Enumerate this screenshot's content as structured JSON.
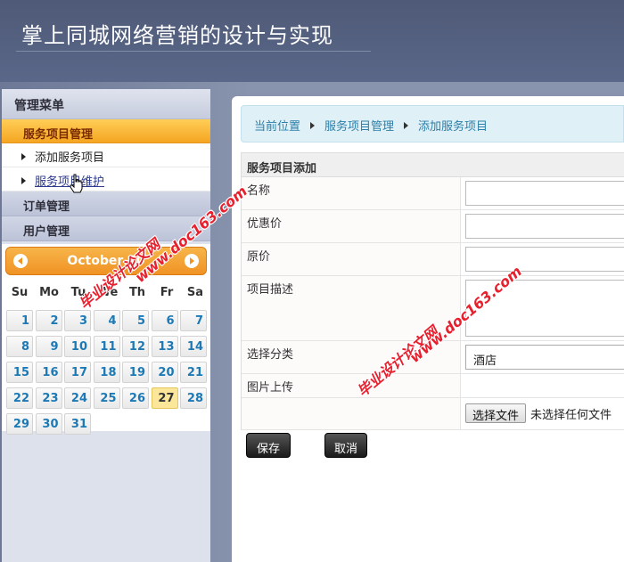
{
  "header": {
    "title": "掌上同城网络营销的设计与实现"
  },
  "sidebar": {
    "title": "管理菜单",
    "active_menu": "服务项目管理",
    "sub_items": [
      "添加服务项目",
      "服务项目维护"
    ],
    "groups": [
      "订单管理",
      "用户管理"
    ]
  },
  "calendar": {
    "month": "October 20",
    "weekdays": [
      "Su",
      "Mo",
      "Tu",
      "We",
      "Th",
      "Fr",
      "Sa"
    ],
    "days": [
      "1",
      "2",
      "3",
      "4",
      "5",
      "6",
      "7",
      "8",
      "9",
      "10",
      "11",
      "12",
      "13",
      "14",
      "15",
      "16",
      "17",
      "18",
      "19",
      "20",
      "21",
      "22",
      "23",
      "24",
      "25",
      "26",
      "27",
      "28",
      "29",
      "30",
      "31"
    ],
    "today": "27"
  },
  "breadcrumb": [
    "当前位置",
    "服务项目管理",
    "添加服务项目"
  ],
  "form": {
    "title": "服务项目添加",
    "fields": {
      "name_label": "名称",
      "discount_label": "优惠价",
      "price_label": "原价",
      "desc_label": "项目描述",
      "category_label": "选择分类",
      "category_value": "酒店",
      "image_label": "图片上传",
      "file_button": "选择文件",
      "file_status": "未选择任何文件"
    },
    "save_label": "保存",
    "cancel_label": "取消"
  },
  "watermark": {
    "text_a": "毕业设计论文网",
    "text_b": "www.doc163.com"
  }
}
